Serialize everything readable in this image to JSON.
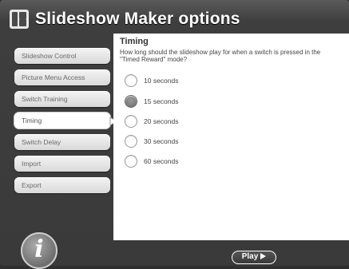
{
  "app": {
    "title": "Slideshow Maker options"
  },
  "sidebar": {
    "items": [
      {
        "label": "Slideshow Control"
      },
      {
        "label": "Picture Menu Access"
      },
      {
        "label": "Switch Training"
      },
      {
        "label": "Timing",
        "active": true
      },
      {
        "label": "Switch Delay"
      },
      {
        "label": "Import"
      },
      {
        "label": "Export"
      }
    ]
  },
  "panel": {
    "heading": "Timing",
    "description": "How long should the slideshow play for when a switch is pressed in the \"Timed Reward\" mode?",
    "selected_option": "15 seconds",
    "options": [
      {
        "label": "10 seconds"
      },
      {
        "label": "15 seconds"
      },
      {
        "label": "20 seconds"
      },
      {
        "label": "30 seconds"
      },
      {
        "label": "60 seconds"
      }
    ]
  },
  "footer": {
    "info_label": "i",
    "play_label": "Play"
  },
  "colors": {
    "window": "#3a3a3a",
    "panel": "#ffffff",
    "selected_radio": "#7a7a7a"
  },
  "icons": {
    "app": "app-grid-icon",
    "info": "info-icon",
    "play": "play-icon",
    "arrow": "arrow-right-icon"
  }
}
